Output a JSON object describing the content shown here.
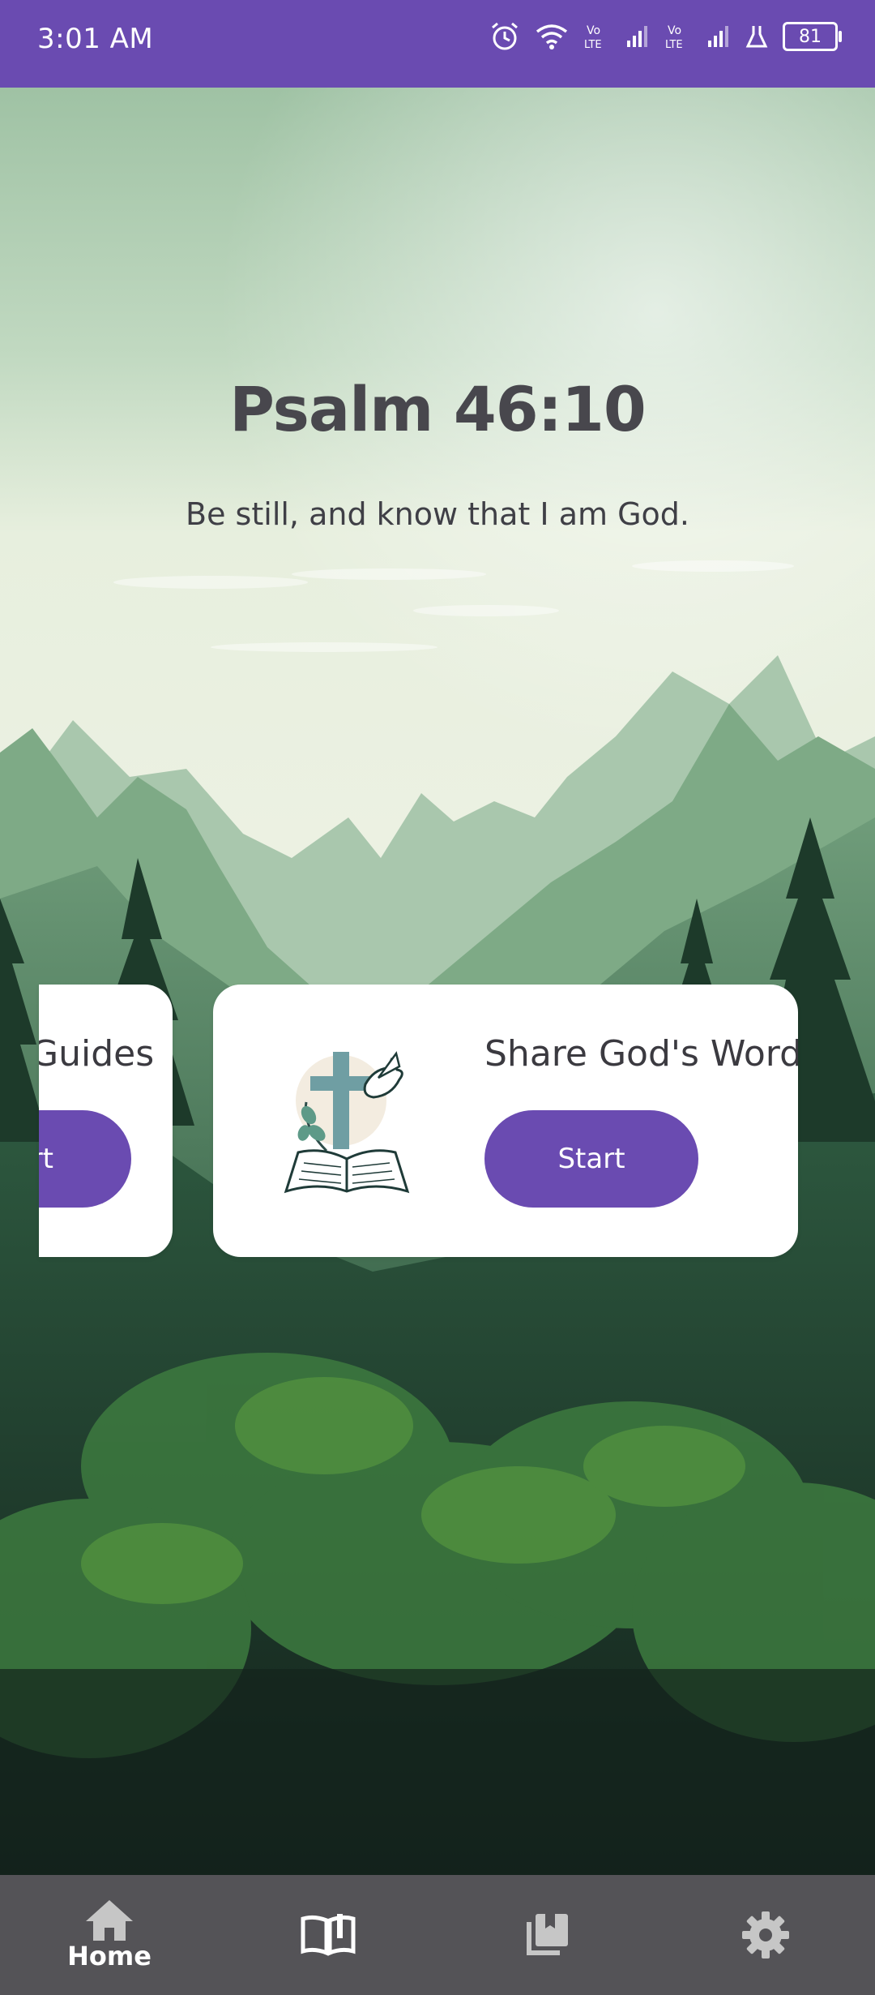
{
  "status_bar": {
    "time": "3:01 AM",
    "battery_level": "81",
    "icons": [
      "alarm-icon",
      "wifi-icon",
      "volte-icon",
      "signal-icon",
      "volte-icon",
      "signal-icon",
      "lab-icon",
      "battery-icon"
    ]
  },
  "verse": {
    "reference": "Psalm 46:10",
    "text": "Be still, and know that I am God."
  },
  "cards": [
    {
      "title": "Guides",
      "button": "rt"
    },
    {
      "title": "Share God's Word",
      "button": "Start",
      "icon": "bible-cross-dove-icon"
    }
  ],
  "bottom_nav": {
    "items": [
      {
        "label": "Home",
        "icon": "home-icon",
        "active": true
      },
      {
        "label": "",
        "icon": "bible-icon"
      },
      {
        "label": "",
        "icon": "library-icon"
      },
      {
        "label": "",
        "icon": "gear-icon"
      }
    ]
  },
  "colors": {
    "accent": "#6a4bb1",
    "nav_background": "#545357",
    "card_background": "#ffffff",
    "title_text": "#48474d"
  }
}
